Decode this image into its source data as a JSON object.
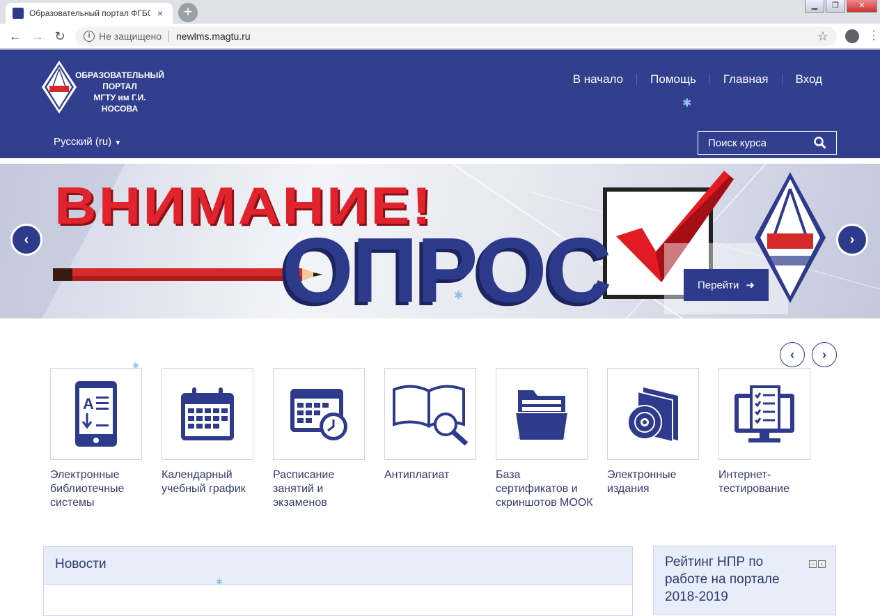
{
  "browser": {
    "tab_title": "Образовательный портал ФГБО",
    "tab_close": "×",
    "new_tab": "+",
    "security_label": "Не защищено",
    "url": "newlms.magtu.ru"
  },
  "header": {
    "logo_badge": "МГТУ",
    "logo_lines": [
      "ОБРАЗОВАТЕЛЬНЫЙ",
      "ПОРТАЛ",
      "МГТУ им Г.И. НОСОВА"
    ],
    "nav": [
      "В начало",
      "Помощь",
      "Главная",
      "Вход"
    ],
    "language": "Русский (ru)",
    "search_placeholder": "Поиск курса"
  },
  "banner": {
    "headline": "ВНИМАНИЕ!",
    "subheadline": "ОПРОС",
    "button": "Перейти"
  },
  "tiles": [
    {
      "label": "Электронные библиотечные системы",
      "icon": "ebook-icon"
    },
    {
      "label": "Календарный учебный график",
      "icon": "calendar-icon"
    },
    {
      "label": "Расписание занятий и экзаменов",
      "icon": "schedule-icon"
    },
    {
      "label": "Антиплагиат",
      "icon": "book-search-icon"
    },
    {
      "label": "База сертификатов и скриншотов МООК",
      "icon": "folder-icon"
    },
    {
      "label": "Электронные издания",
      "icon": "disc-icon"
    },
    {
      "label": "Интернет-тестирование",
      "icon": "monitor-test-icon"
    }
  ],
  "blocks": {
    "news_title": "Новости",
    "rating_title": "Рейтинг НПР по работе на портале 2018-2019"
  },
  "colors": {
    "brand": "#323e8e",
    "accent_red": "#e0232c",
    "block_bg": "#e7eefa"
  }
}
